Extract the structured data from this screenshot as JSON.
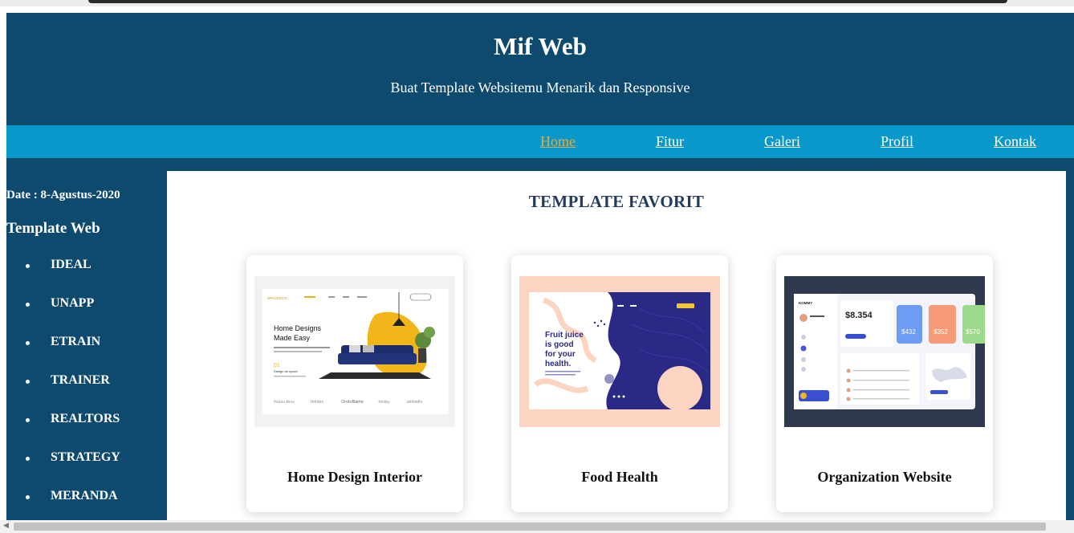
{
  "header": {
    "title": "Mif Web",
    "subtitle": "Buat Template Websitemu Menarik dan Responsive"
  },
  "nav": {
    "items": [
      "Home",
      "Fitur",
      "Galeri",
      "Profil",
      "Kontak"
    ],
    "active": "Home"
  },
  "sidebar": {
    "date": "Date : 8-Agustus-2020",
    "title": "Template Web",
    "items": [
      "IDEAL",
      "UNAPP",
      "ETRAIN",
      "TRAINER",
      "REALTORS",
      "STRATEGY",
      "MERANDA"
    ]
  },
  "main": {
    "heading": "TEMPLATE FAVORIT",
    "cards": [
      {
        "caption": "Home Design Interior",
        "thumb": {
          "logo": "SPACEDOX",
          "headline1": "Home Designs",
          "headline2": "Made Easy",
          "badge": "Design an space",
          "brands": [
            "Patton Bros",
            "mintec",
            "OroloBame",
            "Trintiny",
            "ambrello"
          ]
        }
      },
      {
        "caption": "Food Health",
        "thumb": {
          "headline1": "Fruit juice",
          "headline2": "is good",
          "headline3": "for your",
          "headline4": "health."
        }
      },
      {
        "caption": "Organization Website",
        "thumb": {
          "brand": "KOMMY",
          "stat_main": "8.354",
          "stat_a": "432",
          "stat_b": "352",
          "stat_c": "570"
        }
      }
    ]
  },
  "colors": {
    "dark_blue": "#0d4a6e",
    "nav_blue": "#0898c9",
    "active_link": "#f0a830",
    "heading": "#243a5e"
  }
}
